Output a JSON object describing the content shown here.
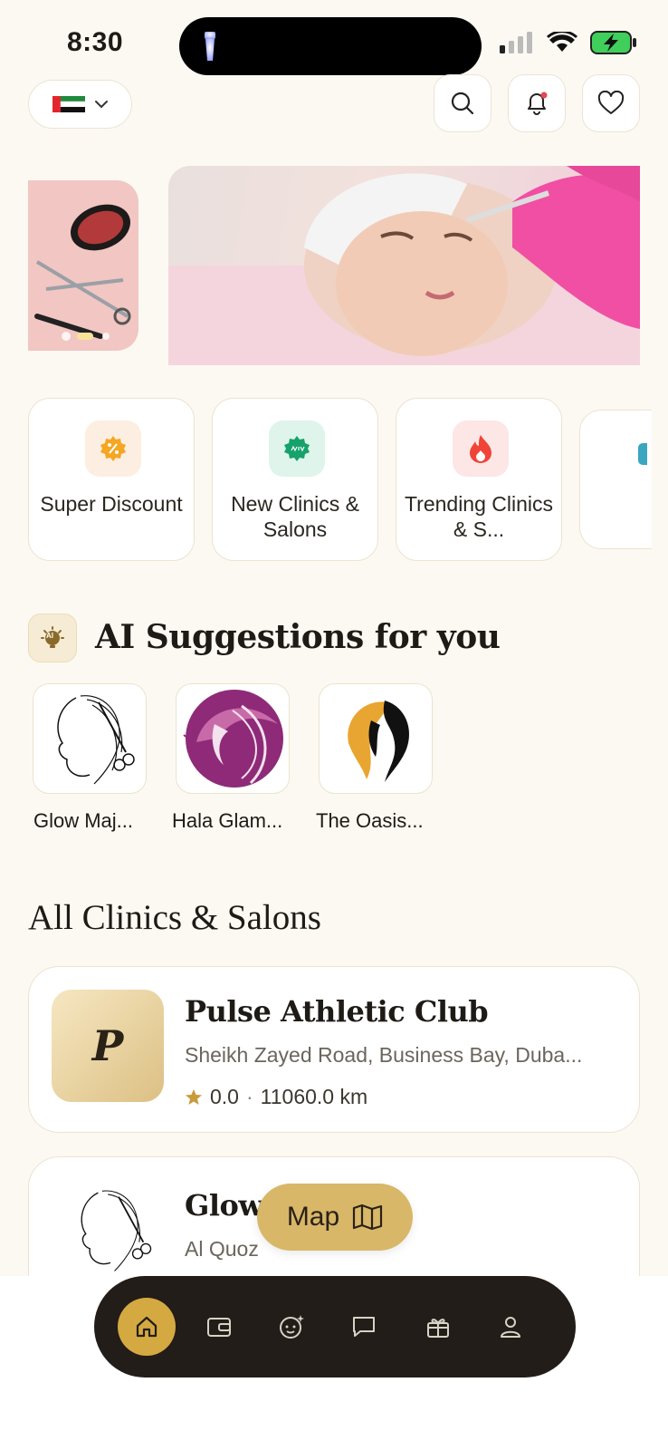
{
  "status_bar": {
    "time": "8:30"
  },
  "top_bar": {
    "country": "UAE flag"
  },
  "categories": [
    {
      "label": "Super Discount",
      "icon": "discount-badge-icon",
      "bg": "#fdeee2",
      "fg": "#f5a623"
    },
    {
      "label": "New Clinics & Salons",
      "icon": "new-badge-icon",
      "bg": "#dff4ea",
      "fg": "#16a26a"
    },
    {
      "label": "Trending Clinics & S...",
      "icon": "fire-icon",
      "bg": "#fde6e6",
      "fg": "#f04438"
    }
  ],
  "ai_section": {
    "badge": "AI",
    "title": "AI Suggestions for you",
    "items": [
      {
        "name": "Glow Maj..."
      },
      {
        "name": "Hala Glam..."
      },
      {
        "name": "The Oasis..."
      }
    ]
  },
  "all_section": {
    "title": "All Clinics & Salons",
    "listings": [
      {
        "logo_letter": "P",
        "name": "Pulse Athletic Club",
        "address": "Sheikh Zayed Road, Business Bay, Duba...",
        "rating": "0.0",
        "distance": "11060.0 km"
      },
      {
        "name": "Glow",
        "address": "Al Quoz"
      }
    ]
  },
  "map_button": {
    "label": "Map"
  },
  "colors": {
    "accent": "#d4a942",
    "background": "#fcf9f3",
    "nav": "#221d18"
  }
}
